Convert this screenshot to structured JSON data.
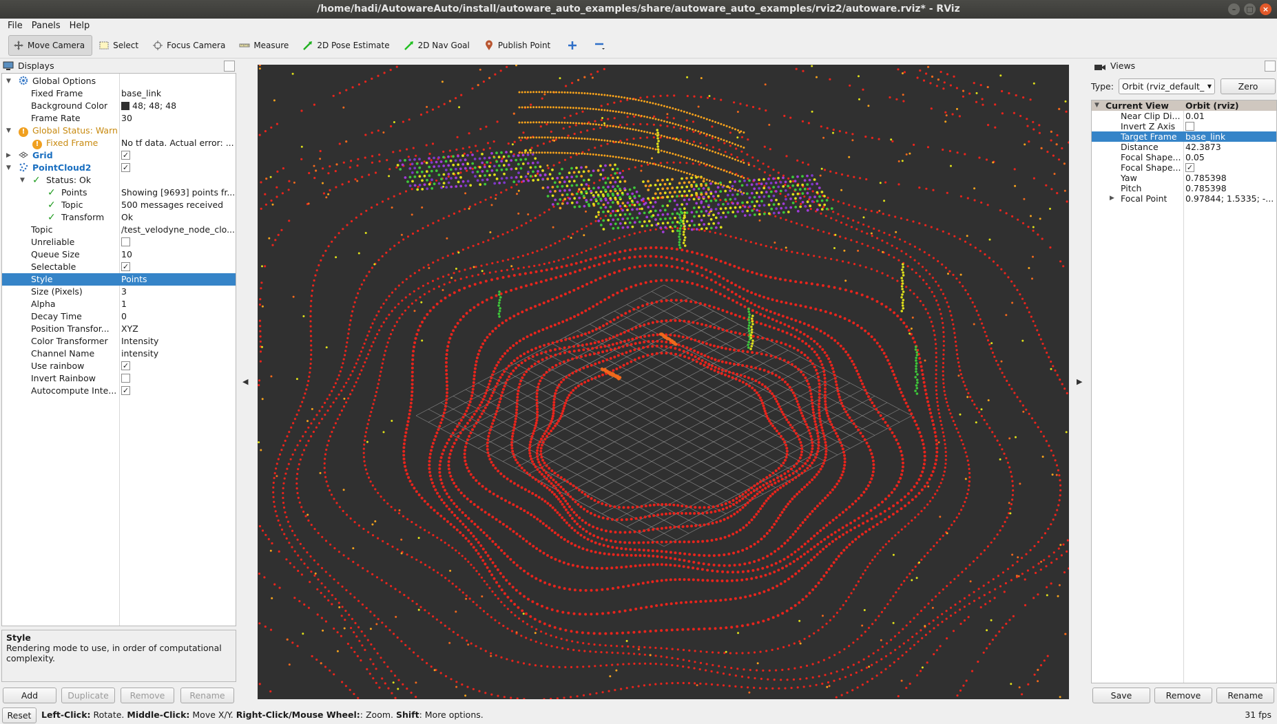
{
  "window": {
    "title": "/home/hadi/AutowareAuto/install/autoware_auto_examples/share/autoware_auto_examples/rviz2/autoware.rviz* - RViz",
    "buttons": {
      "minimize": "–",
      "maximize": "□",
      "close": "×"
    }
  },
  "menu": {
    "items": [
      "File",
      "Panels",
      "Help"
    ]
  },
  "toolbar": {
    "tools": [
      {
        "label": "Move Camera",
        "icon": "move-camera-icon",
        "active": true
      },
      {
        "label": "Select",
        "icon": "select-icon"
      },
      {
        "label": "Focus Camera",
        "icon": "focus-camera-icon"
      },
      {
        "label": "Measure",
        "icon": "measure-icon"
      },
      {
        "label": "2D Pose Estimate",
        "icon": "pose-estimate-icon"
      },
      {
        "label": "2D Nav Goal",
        "icon": "nav-goal-icon"
      },
      {
        "label": "Publish Point",
        "icon": "publish-point-icon"
      }
    ],
    "add_tool_icon": "plus-icon",
    "remove_tool_icon": "minus-icon"
  },
  "displays": {
    "title": "Displays",
    "rows": {
      "global_options": "Global Options",
      "fixed_frame": {
        "label": "Fixed Frame",
        "value": "base_link"
      },
      "background_color": {
        "label": "Background Color",
        "value": "48; 48; 48"
      },
      "frame_rate": {
        "label": "Frame Rate",
        "value": "30"
      },
      "global_status": "Global Status: Warn",
      "fixed_frame_warn": {
        "label": "Fixed Frame",
        "value": "No tf data.  Actual error: ..."
      },
      "grid": "Grid",
      "pointcloud2": "PointCloud2",
      "status_ok": "Status: Ok",
      "points": {
        "label": "Points",
        "value": "Showing [9693] points fr..."
      },
      "topic_status": {
        "label": "Topic",
        "value": "500 messages received"
      },
      "transform": {
        "label": "Transform",
        "value": "Ok"
      },
      "topic": {
        "label": "Topic",
        "value": "/test_velodyne_node_clo..."
      },
      "unreliable": {
        "label": "Unreliable"
      },
      "queue_size": {
        "label": "Queue Size",
        "value": "10"
      },
      "selectable": {
        "label": "Selectable"
      },
      "style": {
        "label": "Style",
        "value": "Points"
      },
      "size_pixels": {
        "label": "Size (Pixels)",
        "value": "3"
      },
      "alpha": {
        "label": "Alpha",
        "value": "1"
      },
      "decay_time": {
        "label": "Decay Time",
        "value": "0"
      },
      "position_transformer": {
        "label": "Position Transfor...",
        "value": "XYZ"
      },
      "color_transformer": {
        "label": "Color Transformer",
        "value": "Intensity"
      },
      "channel_name": {
        "label": "Channel Name",
        "value": "intensity"
      },
      "use_rainbow": {
        "label": "Use rainbow"
      },
      "invert_rainbow": {
        "label": "Invert Rainbow"
      },
      "autocompute": {
        "label": "Autocompute Inte..."
      }
    },
    "checks": {
      "grid": true,
      "pointcloud2": true,
      "unreliable": false,
      "selectable": true,
      "use_rainbow": true,
      "invert_rainbow": false,
      "autocompute": true
    },
    "description": {
      "title": "Style",
      "text": "Rendering mode to use, in order of computational complexity."
    },
    "buttons": {
      "add": "Add",
      "duplicate": "Duplicate",
      "remove": "Remove",
      "rename": "Rename"
    }
  },
  "viewport": {
    "background": "#303030",
    "left_arrow": "◀",
    "right_arrow": "▶",
    "point_colors": [
      "#e8241c",
      "#f0681c",
      "#f6a21c",
      "#dfe01a",
      "#3ec83a",
      "#a03cd8",
      "#7c38c8"
    ]
  },
  "views": {
    "title": "Views",
    "type_label": "Type:",
    "type_value": "Orbit (rviz_default_",
    "zero_button": "Zero",
    "header": {
      "label": "Current View",
      "value": "Orbit (rviz)"
    },
    "rows": [
      {
        "label": "Near Clip Di...",
        "value": "0.01"
      },
      {
        "label": "Invert Z Axis",
        "value": ""
      },
      {
        "label": "Target Frame",
        "value": "base_link"
      },
      {
        "label": "Distance",
        "value": "42.3873"
      },
      {
        "label": "Focal Shape...",
        "value": "0.05"
      },
      {
        "label": "Focal Shape...",
        "value": ""
      },
      {
        "label": "Yaw",
        "value": "0.785398"
      },
      {
        "label": "Pitch",
        "value": "0.785398"
      },
      {
        "label": "Focal Point",
        "value": "0.97844; 1.5335; -..."
      }
    ],
    "checks": {
      "invert_z": false,
      "focal_fixed": true
    },
    "buttons": {
      "save": "Save",
      "remove": "Remove",
      "rename": "Rename"
    }
  },
  "statusbar": {
    "reset": "Reset",
    "hint": [
      {
        "b": "Left-Click:",
        "t": " Rotate. "
      },
      {
        "b": "Middle-Click:",
        "t": " Move X/Y. "
      },
      {
        "b": "Right-Click/Mouse Wheel:",
        "t": ": Zoom. "
      },
      {
        "b": "Shift",
        "t": ": More options."
      }
    ],
    "fps": "31 fps"
  }
}
